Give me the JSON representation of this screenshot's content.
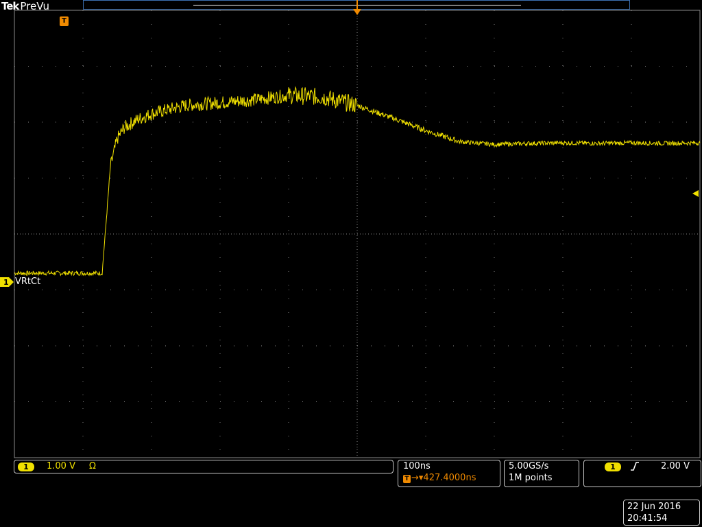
{
  "brand": {
    "logo": "Tek",
    "mode": "PreVu"
  },
  "trigger_marker_label": "T",
  "channel": {
    "id": "1",
    "label": "VRtCt",
    "scale": "1.00 V",
    "coupling": "Ω",
    "color": "#f0e000"
  },
  "horizontal": {
    "scale": "100ns",
    "delay": "427.4000ns",
    "delay_prefix": "→▾"
  },
  "acquisition": {
    "sample_rate": "5.00GS/s",
    "record_length": "1M points"
  },
  "trigger": {
    "source": "1",
    "slope": "rising",
    "level": "2.00 V"
  },
  "timestamp": {
    "date": "22 Jun 2016",
    "time": "20:41:54"
  },
  "colors": {
    "trace": "#f0e000",
    "trigger": "#f08a00",
    "graticule": "#8a8a8a",
    "record_bar": "#3b6fb0"
  },
  "chart_data": {
    "type": "line",
    "xlabel": "",
    "ylabel": "",
    "x_unit": "div",
    "y_unit": "div",
    "xlim": [
      -5,
      5
    ],
    "ylim": [
      -4,
      4
    ],
    "grid": true,
    "series": [
      {
        "name": "VRtCt",
        "x": [
          -5.0,
          -3.72,
          -3.65,
          -3.6,
          -3.5,
          -3.4,
          -3.2,
          -3.0,
          -2.5,
          -2.0,
          -1.5,
          -1.0,
          -0.5,
          0.0,
          0.5,
          1.0,
          1.5,
          2.0,
          2.5,
          3.0,
          3.5,
          4.0,
          4.5,
          5.0
        ],
        "values": [
          -0.7,
          -0.7,
          0.4,
          1.2,
          1.7,
          1.9,
          2.05,
          2.15,
          2.3,
          2.35,
          2.4,
          2.48,
          2.45,
          2.3,
          2.08,
          1.85,
          1.65,
          1.6,
          1.62,
          1.63,
          1.62,
          1.63,
          1.62,
          1.63
        ]
      }
    ]
  }
}
